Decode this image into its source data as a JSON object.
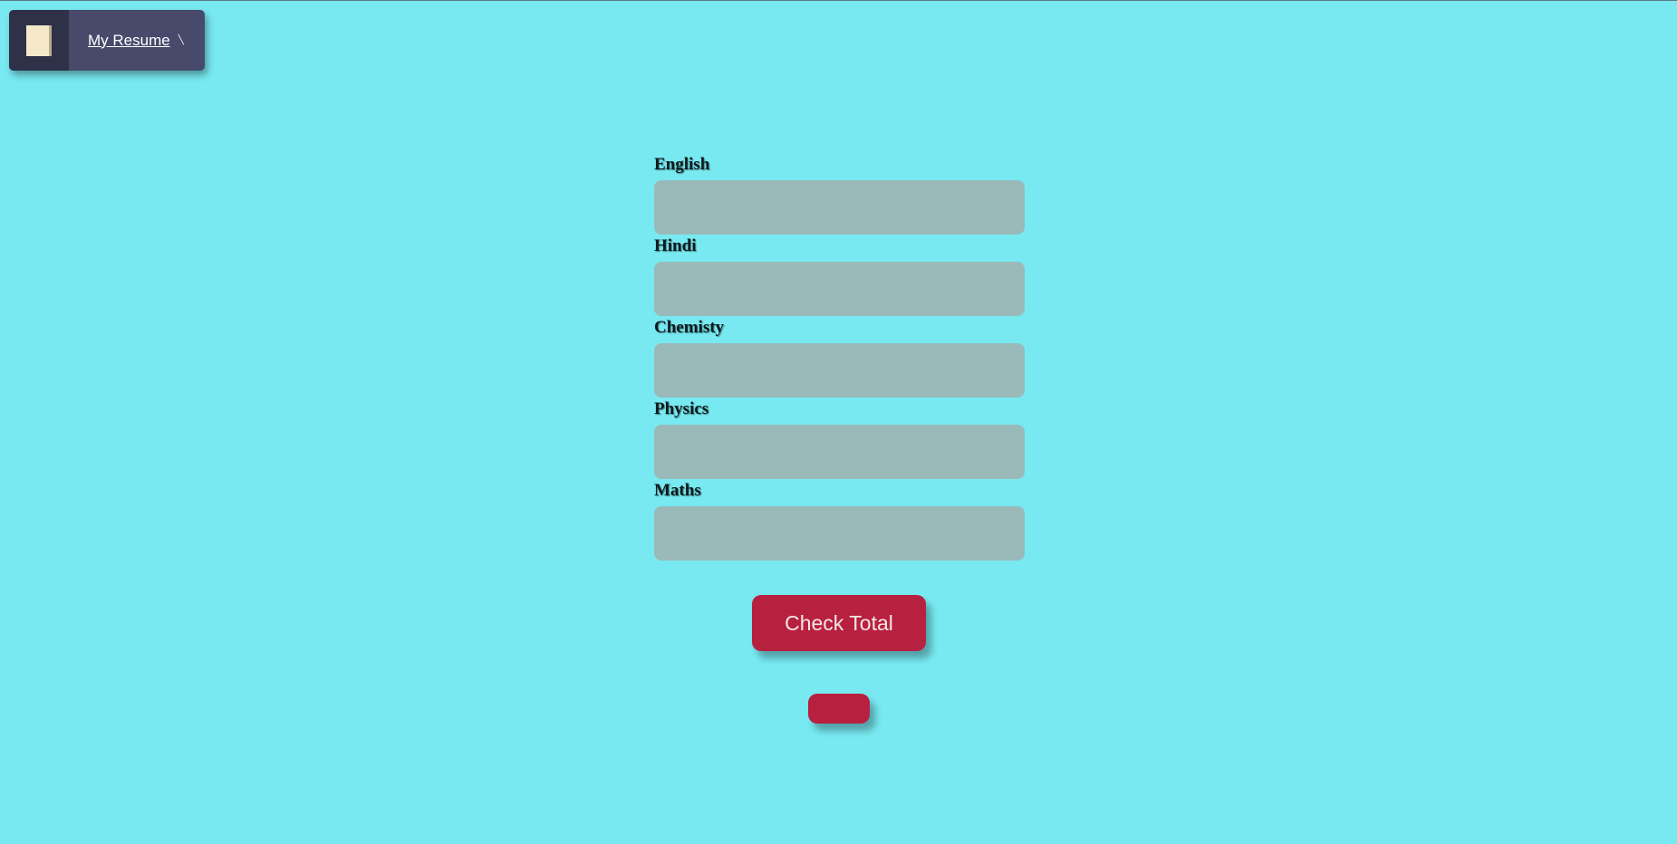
{
  "bookmark": {
    "label": "My Resume",
    "icon": "document-icon"
  },
  "form": {
    "fields": [
      {
        "label": "English",
        "value": ""
      },
      {
        "label": "Hindi",
        "value": ""
      },
      {
        "label": "Chemisty",
        "value": ""
      },
      {
        "label": "Physics",
        "value": ""
      },
      {
        "label": "Maths",
        "value": ""
      }
    ],
    "check_button_label": "Check Total",
    "result_text": ""
  },
  "colors": {
    "background": "#78e9f1",
    "input": "#9ababa",
    "button": "#b82040",
    "bookmark": "#474a6a"
  }
}
